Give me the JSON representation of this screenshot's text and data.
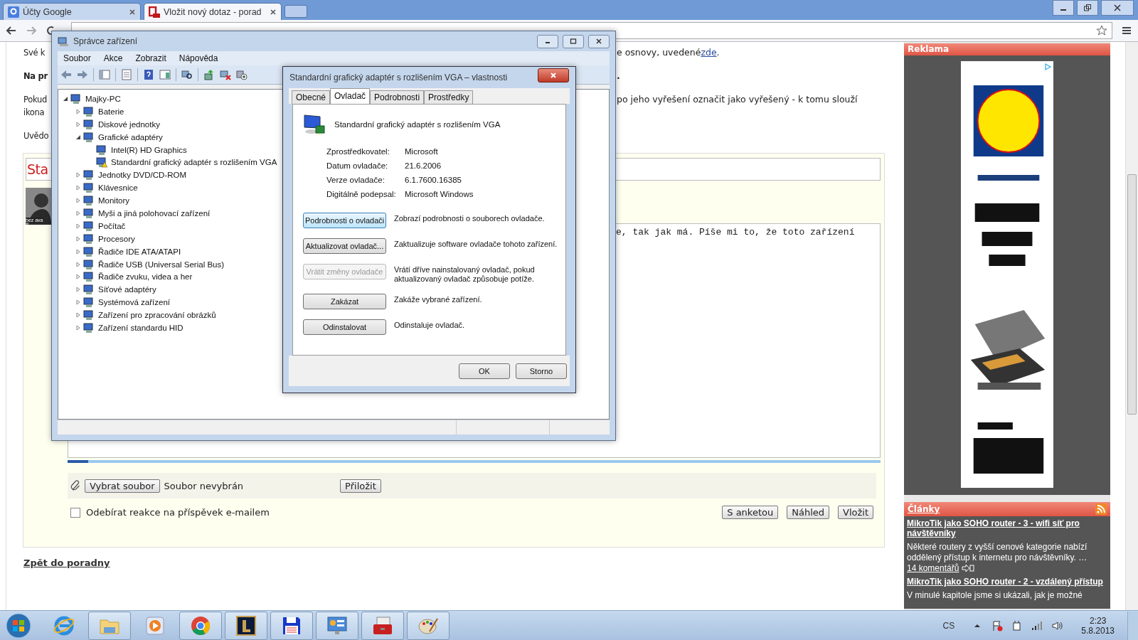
{
  "browser": {
    "tabs": [
      {
        "title": "Účty Google",
        "selected": false
      },
      {
        "title": "Vložit nový dotaz - porad",
        "selected": true
      }
    ]
  },
  "page": {
    "paragraphs": [
      {
        "left": [
          "Své k"
        ],
        "bold": false,
        "right": "e osnovy, uvedené",
        "link": "zde",
        "after": "."
      },
      {
        "left": [
          "Na pr"
        ],
        "bold": true,
        "right": "."
      },
      {
        "left": [
          "Pokud",
          "ikona"
        ],
        "bold": false,
        "right": "po jeho vyřešení označit jako vyřešený - k tomu slouží"
      },
      {
        "left": [
          "Uvědo"
        ],
        "bold": false
      }
    ],
    "form": {
      "title_value": "Sta",
      "avatar_caption": "bez ava",
      "body_value": "e, tak jak má. Píše mi to, že toto zařízení",
      "upload": {
        "level": 0.025
      },
      "file_button": "Vybrat soubor",
      "file_status": "Soubor nevybrán",
      "attach_button": "Přiložit",
      "subscribe": {
        "label": "Odebírat reakce na příspěvek e-mailem",
        "checked": false
      },
      "buttons": [
        "S anketou",
        "Náhled",
        "Vložit"
      ]
    },
    "back_link": "Zpět do poradny"
  },
  "sidebar": {
    "ad_title": "Reklama",
    "articles_title": "Články",
    "articles": [
      {
        "title": "MikroTik jako SOHO router - 3 - wifi síť pro návštěvníky",
        "summary": "Některé routery z vyšší cenové kategorie nabízí oddělený přístup k internetu pro návštěvníky. …",
        "comments": "14 komentářů"
      },
      {
        "title": "MikroTik jako SOHO router - 2 - vzdálený přístup",
        "summary": "V minulé kapitole jsme si ukázali, jak je možné"
      }
    ]
  },
  "device_manager": {
    "title": "Správce zařízení",
    "menu": [
      "Soubor",
      "Akce",
      "Zobrazit",
      "Nápověda"
    ],
    "tree": {
      "label": "Majky-PC",
      "expanded": true,
      "children": [
        {
          "label": "Baterie",
          "expanded": false
        },
        {
          "label": "Diskové jednotky",
          "expanded": false
        },
        {
          "label": "Grafické adaptéry",
          "expanded": true,
          "children": [
            {
              "label": "Intel(R) HD Graphics",
              "warning": false
            },
            {
              "label": "Standardní grafický adaptér s rozlišením VGA",
              "warning": true
            }
          ]
        },
        {
          "label": "Jednotky DVD/CD-ROM",
          "expanded": false
        },
        {
          "label": "Klávesnice",
          "expanded": false
        },
        {
          "label": "Monitory",
          "expanded": false
        },
        {
          "label": "Myši a jiná polohovací zařízení",
          "expanded": false
        },
        {
          "label": "Počítač",
          "expanded": false
        },
        {
          "label": "Procesory",
          "expanded": false
        },
        {
          "label": "Řadiče IDE ATA/ATAPI",
          "expanded": false
        },
        {
          "label": "Řadiče USB (Universal Serial Bus)",
          "expanded": false
        },
        {
          "label": "Řadiče zvuku, videa a her",
          "expanded": false
        },
        {
          "label": "Síťové adaptéry",
          "expanded": false
        },
        {
          "label": "Systémová zařízení",
          "expanded": false
        },
        {
          "label": "Zařízení pro zpracování obrázků",
          "expanded": false
        },
        {
          "label": "Zařízení standardu HID",
          "expanded": false
        }
      ]
    }
  },
  "dialog": {
    "title": "Standardní grafický adaptér s rozlišením VGA – vlastnosti",
    "tabs": [
      {
        "label": "Obecné",
        "selected": false
      },
      {
        "label": "Ovladač",
        "selected": true
      },
      {
        "label": "Podrobnosti",
        "selected": false
      },
      {
        "label": "Prostředky",
        "selected": false
      }
    ],
    "device_name": "Standardní grafický adaptér s rozlišením VGA",
    "properties": [
      {
        "label": "Zprostředkovatel:",
        "value": "Microsoft"
      },
      {
        "label": "Datum ovladače:",
        "value": "21.6.2006"
      },
      {
        "label": "Verze ovladače:",
        "value": "6.1.7600.16385"
      },
      {
        "label": "Digitálně podepsal:",
        "value": "Microsoft Windows"
      }
    ],
    "actions": [
      {
        "button": "Podrobnosti o ovladači",
        "description": "Zobrazí podrobnosti o souborech ovladače.",
        "disabled": false,
        "focused": true
      },
      {
        "button": "Aktualizovat ovladač...",
        "description": "Zaktualizuje software ovladače tohoto zařízení.",
        "disabled": false,
        "focused": false
      },
      {
        "button": "Vrátit změny ovladače",
        "description": "Vrátí dříve nainstalovaný ovladač, pokud aktualizovaný ovladač způsobuje potíže.",
        "disabled": true,
        "focused": false
      },
      {
        "button": "Zakázat",
        "description": "Zakáže vybrané zařízení.",
        "disabled": false,
        "focused": false
      },
      {
        "button": "Odinstalovat",
        "description": "Odinstaluje ovladač.",
        "disabled": false,
        "focused": false
      }
    ],
    "buttons": [
      "OK",
      "Storno"
    ]
  },
  "taskbar": {
    "apps": [
      {
        "kind": "ie",
        "running": false
      },
      {
        "kind": "folder",
        "running": true
      },
      {
        "kind": "media",
        "running": false
      },
      {
        "kind": "chrome",
        "running": true
      },
      {
        "kind": "game",
        "running": true
      },
      {
        "kind": "floppy",
        "running": true
      },
      {
        "kind": "panel",
        "running": true
      },
      {
        "kind": "toolbox",
        "running": true
      },
      {
        "kind": "palette",
        "running": true
      }
    ],
    "language": "CS",
    "time": "2:23",
    "date": "5.8.2013"
  }
}
